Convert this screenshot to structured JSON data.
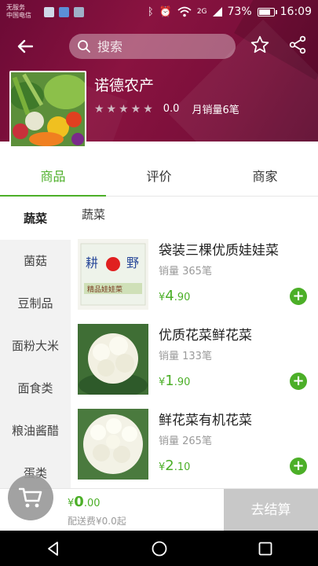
{
  "status_bar": {
    "carrier_line1": "无服务",
    "carrier_line2": "中国电信",
    "signal_label": "2G",
    "battery": "73%",
    "time": "16:09"
  },
  "header": {
    "search_placeholder": "搜索",
    "back_icon": "arrow-left-icon",
    "favorite_icon": "star-outline-icon",
    "share_icon": "share-icon"
  },
  "store": {
    "name": "诺德农产",
    "stars": "★★★★★",
    "rating": "0.0",
    "monthly_sales": "月销量6笔"
  },
  "tabs": [
    "商品",
    "评价",
    "商家"
  ],
  "sidebar": {
    "items": [
      "蔬菜",
      "菌菇",
      "豆制品",
      "面粉大米",
      "面食类",
      "粮油酱醋",
      "蛋类"
    ]
  },
  "category_title": "蔬菜",
  "products": [
    {
      "name": "袋装三棵优质娃娃菜",
      "sales": "销量 365笔",
      "currency": "¥",
      "price_int": "4",
      "price_dec": ".90"
    },
    {
      "name": "优质花菜鲜花菜",
      "sales": "销量 133笔",
      "currency": "¥",
      "price_int": "1",
      "price_dec": ".90"
    },
    {
      "name": "鲜花菜有机花菜",
      "sales": "销量 265笔",
      "currency": "¥",
      "price_int": "2",
      "price_dec": ".10"
    }
  ],
  "cart": {
    "currency": "¥",
    "total_int": "0",
    "total_dec": ".00",
    "delivery": "配送费¥0.0起",
    "checkout_label": "去结算"
  },
  "colors": {
    "accent": "#4caf28",
    "header_bg": "#7a0f3a",
    "checkout_bg": "#c8c8c8"
  }
}
